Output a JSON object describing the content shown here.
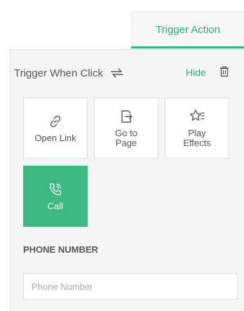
{
  "tab": {
    "label": "Trigger Action"
  },
  "trigger": {
    "label": "Trigger When Click",
    "hide_label": "Hide",
    "swap_icon": "swap-arrows-icon",
    "delete_icon": "trash-icon"
  },
  "actions": [
    {
      "label": "Open Link",
      "icon": "link-icon",
      "selected": false
    },
    {
      "label": "Go to\nPage",
      "icon": "go-to-page-icon",
      "selected": false
    },
    {
      "label": "Play\nEffects",
      "icon": "star-effects-icon",
      "selected": false
    },
    {
      "label": "Call",
      "icon": "phone-call-icon",
      "selected": true
    }
  ],
  "phone": {
    "section_label": "PHONE NUMBER",
    "placeholder": "Phone Number",
    "value": ""
  },
  "colors": {
    "accent": "#3cb883",
    "accent_text": "#27ae74",
    "panel_bg": "#f5f5f5"
  }
}
